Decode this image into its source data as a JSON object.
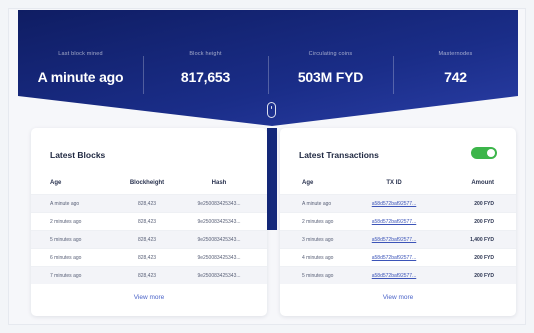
{
  "stats": [
    {
      "label": "Last block mined",
      "value": "A minute ago"
    },
    {
      "label": "Block height",
      "value": "817,653"
    },
    {
      "label": "Circulating coins",
      "value": "503M FYD"
    },
    {
      "label": "Masternodes",
      "value": "742"
    }
  ],
  "latest_blocks": {
    "title": "Latest Blocks",
    "columns": [
      "Age",
      "Blockheight",
      "Hash"
    ],
    "rows": [
      [
        "A minute ago",
        "828,423",
        "9e250083425343..."
      ],
      [
        "2 minutes ago",
        "828,423",
        "9e250083425343..."
      ],
      [
        "5 minutes ago",
        "828,423",
        "9e250083425343..."
      ],
      [
        "6 minutes ago",
        "828,423",
        "9e250083425343..."
      ],
      [
        "7 minutes ago",
        "828,423",
        "9e250083425343..."
      ]
    ],
    "view_more": "View more"
  },
  "latest_transactions": {
    "title": "Latest Transactions",
    "toggle_on": true,
    "columns": [
      "Age",
      "TX ID",
      "Amount"
    ],
    "rows": [
      [
        "A minute ago",
        "a58d572baf92577...",
        "200 FYD"
      ],
      [
        "2 minutes ago",
        "a58d572baf92577...",
        "200 FYD"
      ],
      [
        "3 minutes ago",
        "a58d572baf92577...",
        "1,400 FYD"
      ],
      [
        "4 minutes ago",
        "a58d572baf92577...",
        "200 FYD"
      ],
      [
        "5 minutes ago",
        "a58d572baf92577...",
        "200 FYD"
      ]
    ],
    "view_more": "View more"
  },
  "colors": {
    "hero_dark": "#0f1d63",
    "hero_light": "#2a3ea6",
    "toggle_on": "#3cb54a",
    "link": "#4a63c8"
  },
  "icons": {
    "scroll": "mouse-scroll-icon"
  }
}
